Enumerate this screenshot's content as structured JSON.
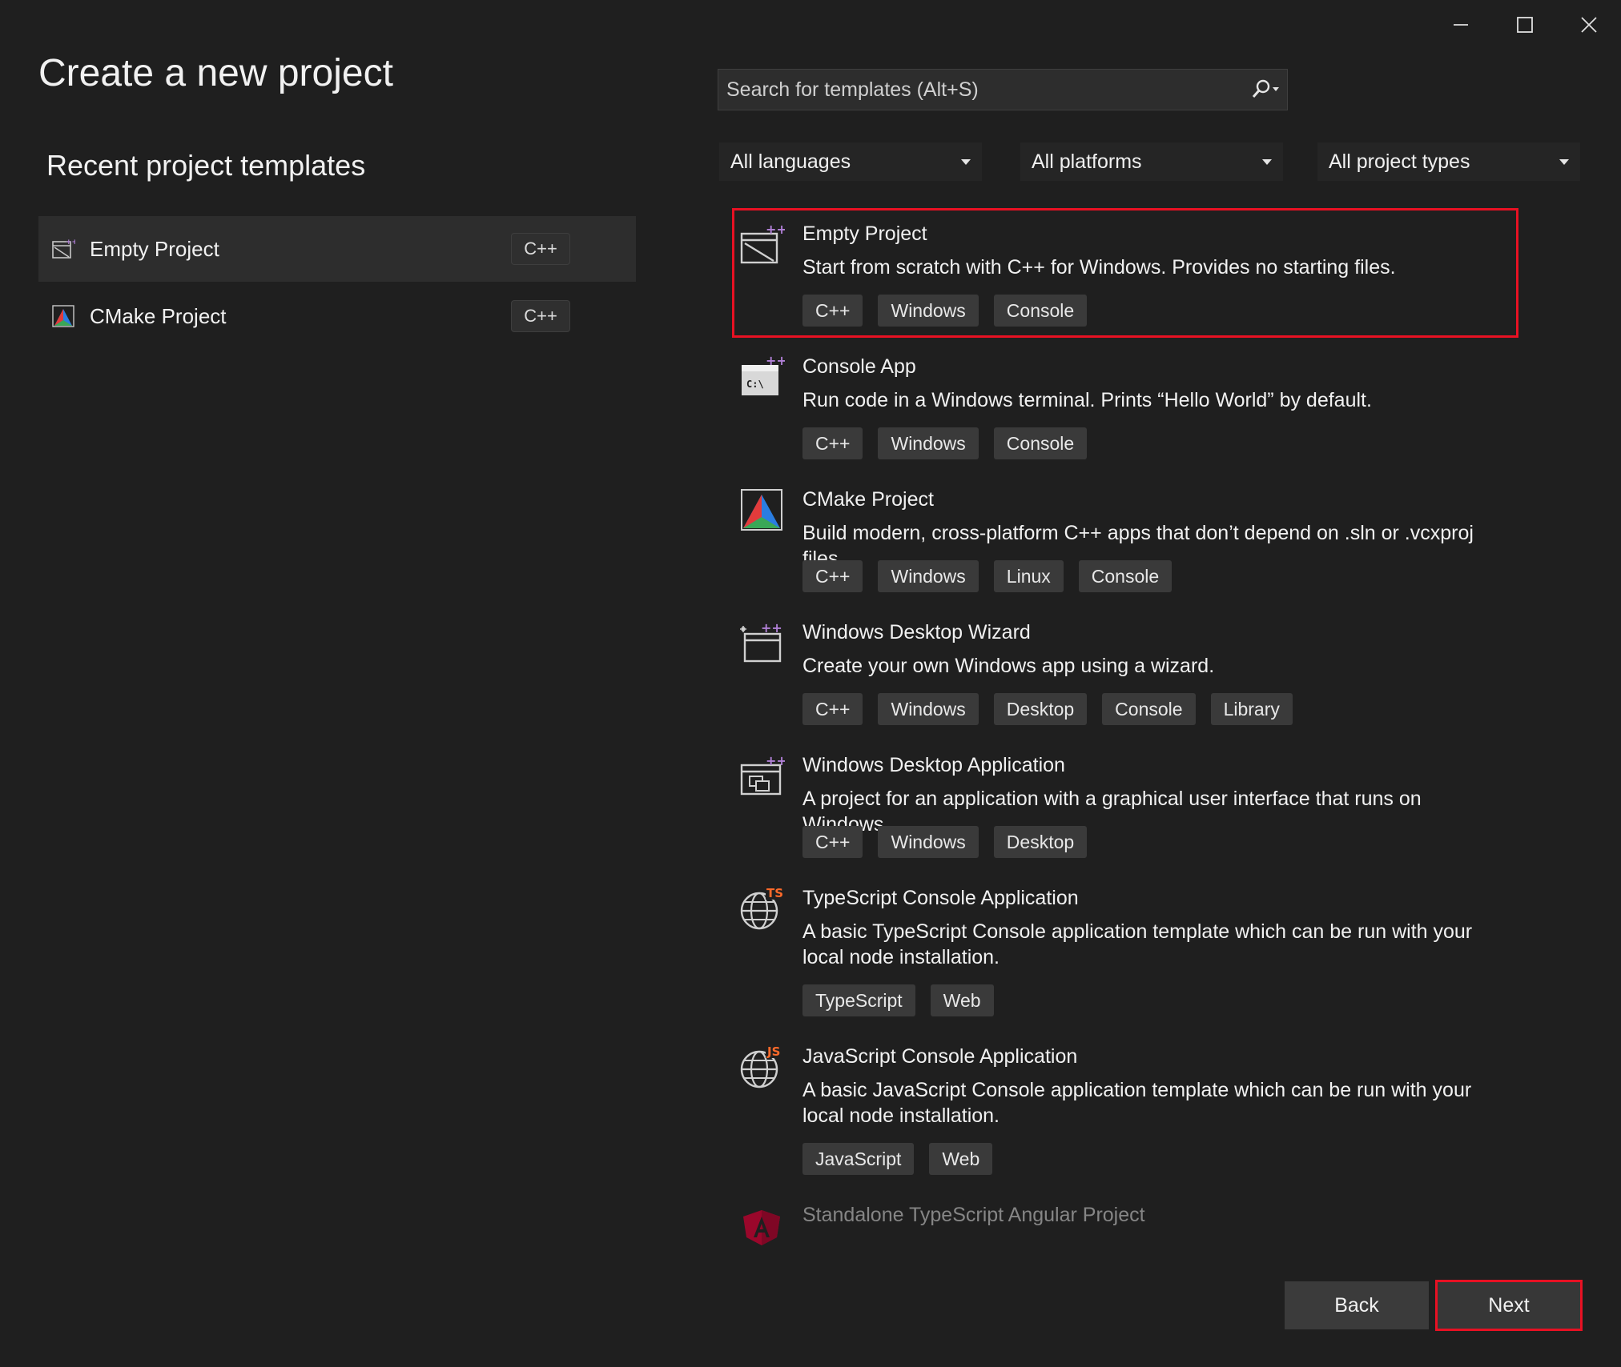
{
  "window": {
    "title": "Create a new project",
    "controls": [
      "minimize-icon",
      "maximize-icon",
      "close-icon"
    ]
  },
  "recent": {
    "heading": "Recent project templates",
    "items": [
      {
        "label": "Empty Project",
        "language": "C++",
        "icon": "empty-project-icon",
        "selected": true
      },
      {
        "label": "CMake Project",
        "language": "C++",
        "icon": "cmake-icon",
        "selected": false
      }
    ]
  },
  "search": {
    "placeholder": "Search for templates (Alt+S)"
  },
  "filters": {
    "language": "All languages",
    "platform": "All platforms",
    "project_type": "All project types"
  },
  "templates": [
    {
      "name": "Empty Project",
      "description": "Start from scratch with C++ for Windows. Provides no starting files.",
      "tags": [
        "C++",
        "Windows",
        "Console"
      ],
      "icon": "empty-project-icon",
      "selected": true
    },
    {
      "name": "Console App",
      "description": "Run code in a Windows terminal. Prints “Hello World” by default.",
      "tags": [
        "C++",
        "Windows",
        "Console"
      ],
      "icon": "console-app-icon"
    },
    {
      "name": "CMake Project",
      "description": "Build modern, cross-platform C++ apps that don’t depend on .sln or .vcxproj files.",
      "tags": [
        "C++",
        "Windows",
        "Linux",
        "Console"
      ],
      "icon": "cmake-icon"
    },
    {
      "name": "Windows Desktop Wizard",
      "description": "Create your own Windows app using a wizard.",
      "tags": [
        "C++",
        "Windows",
        "Desktop",
        "Console",
        "Library"
      ],
      "icon": "wizard-icon"
    },
    {
      "name": "Windows Desktop Application",
      "description": "A project for an application with a graphical user interface that runs on Windows.",
      "tags": [
        "C++",
        "Windows",
        "Desktop"
      ],
      "icon": "desktop-app-icon"
    },
    {
      "name": "TypeScript Console Application",
      "description": "A basic TypeScript Console application template which can be run with your local node installation.",
      "tags": [
        "TypeScript",
        "Web"
      ],
      "icon": "typescript-globe-icon"
    },
    {
      "name": "JavaScript Console Application",
      "description": "A basic JavaScript Console application template which can be run with your local node installation.",
      "tags": [
        "JavaScript",
        "Web"
      ],
      "icon": "javascript-globe-icon"
    },
    {
      "name": "Standalone TypeScript Angular Project",
      "description": "",
      "tags": [],
      "icon": "angular-icon"
    }
  ],
  "buttons": {
    "back": "Back",
    "next": "Next"
  },
  "colors": {
    "background": "#1f1f1f",
    "highlight": "#e81123",
    "tag_bg": "#3a3a3a",
    "cpp_purple": "#b180d7"
  }
}
